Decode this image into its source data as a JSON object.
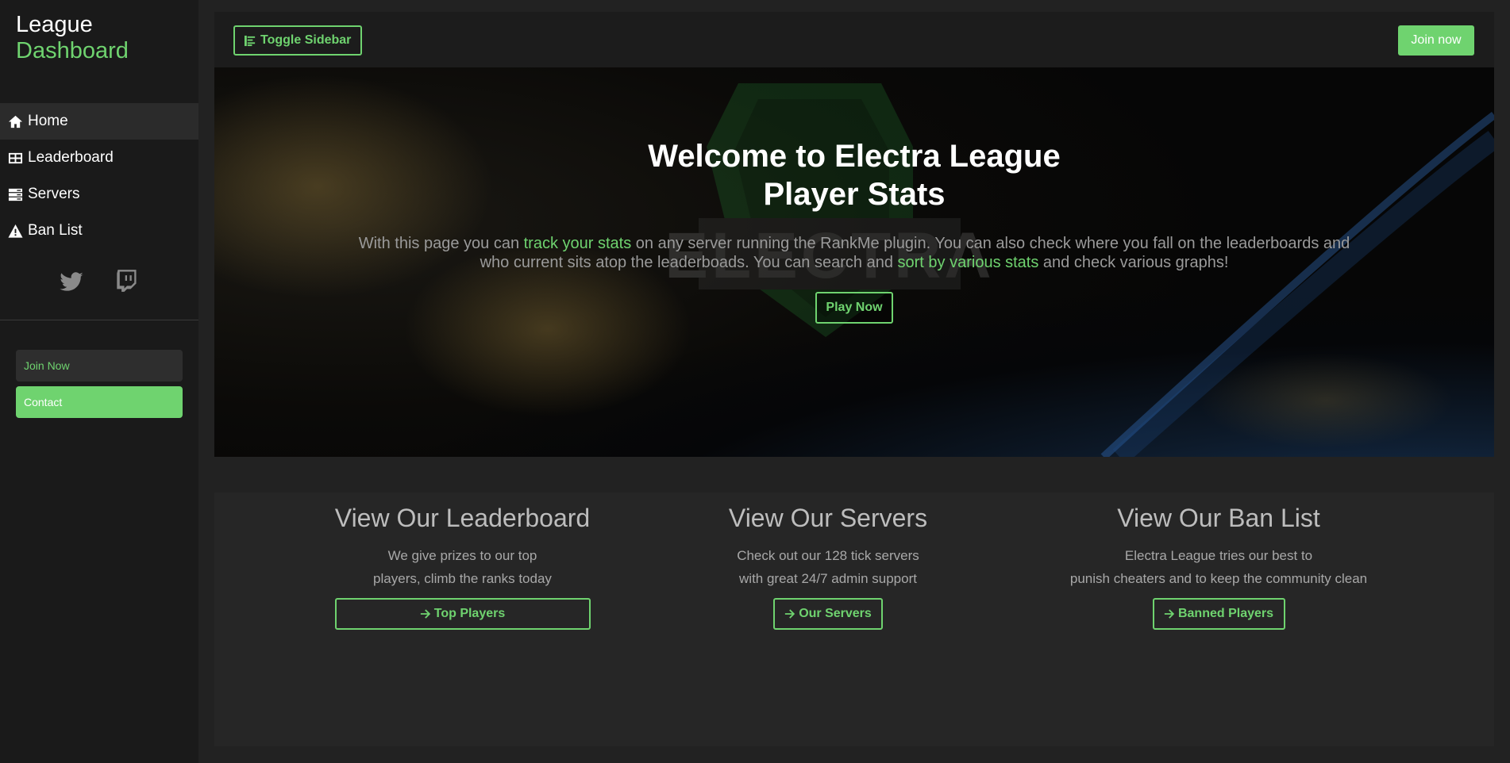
{
  "brand": {
    "line1": "League",
    "line2": "Dashboard"
  },
  "sidebar": {
    "items": [
      {
        "label": "Home",
        "icon": "home-icon",
        "active": true
      },
      {
        "label": "Leaderboard",
        "icon": "table-icon",
        "active": false
      },
      {
        "label": "Servers",
        "icon": "server-icon",
        "active": false
      },
      {
        "label": "Ban List",
        "icon": "warning-icon",
        "active": false
      }
    ],
    "social": [
      "twitter-icon",
      "twitch-icon"
    ],
    "join_label": "Join Now",
    "contact_label": "Contact"
  },
  "topbar": {
    "toggle_label": "Toggle Sidebar",
    "join_label": "Join now"
  },
  "hero": {
    "title_line1": "Welcome to Electra League",
    "title_line2": "Player Stats",
    "text_1": "With this page you can ",
    "highlight_1": "track your stats",
    "text_2": " on any server running the RankMe plugin. You can also check where you fall on the leaderboards and who current sits atop the leaderboads. You can search and ",
    "highlight_2": "sort by various stats",
    "text_3": " and check various graphs!",
    "play_label": "Play Now"
  },
  "features": [
    {
      "title": "View Our Leaderboard",
      "desc_line1": "We give prizes to our top",
      "desc_line2": "players, climb the ranks today",
      "button": "Top Players"
    },
    {
      "title": "View Our Servers",
      "desc_line1": "Check out our 128 tick servers",
      "desc_line2": "with great 24/7 admin support",
      "button": "Our Servers"
    },
    {
      "title": "View Our Ban List",
      "desc_line1": "Electra League tries our best to",
      "desc_line2": "punish cheaters and to keep the community clean",
      "button": "Banned Players"
    }
  ],
  "colors": {
    "accent": "#6fd36f",
    "sidebar_bg": "#1a1a1a",
    "page_bg": "#222222"
  }
}
